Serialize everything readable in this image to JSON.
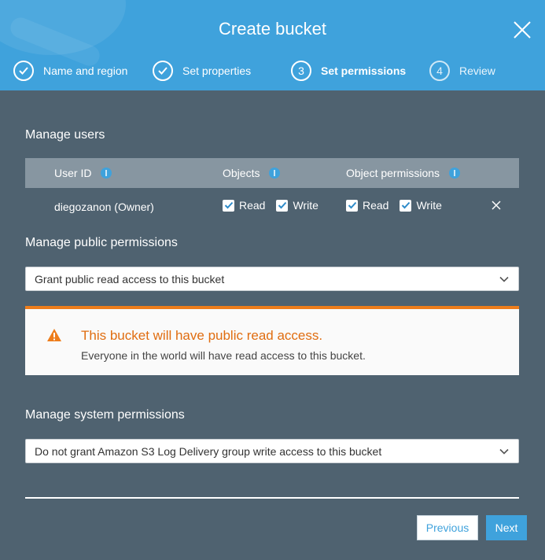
{
  "header": {
    "title": "Create bucket",
    "steps": [
      {
        "number": "",
        "label": "Name and region",
        "state": "done"
      },
      {
        "number": "",
        "label": "Set properties",
        "state": "done"
      },
      {
        "number": "3",
        "label": "Set permissions",
        "state": "current"
      },
      {
        "number": "4",
        "label": "Review",
        "state": "todo"
      }
    ]
  },
  "manage_users": {
    "title": "Manage users",
    "columns": [
      "User ID",
      "Objects",
      "Object permissions"
    ],
    "rows": [
      {
        "user": "diegozanon (Owner)",
        "objects_read_label": "Read",
        "objects_write_label": "Write",
        "perm_read_label": "Read",
        "perm_write_label": "Write",
        "objects_read": true,
        "objects_write": true,
        "perm_read": true,
        "perm_write": true
      }
    ]
  },
  "public_permissions": {
    "title": "Manage public permissions",
    "selected": "Grant public read access to this bucket"
  },
  "alert": {
    "title": "This bucket will have public read access.",
    "body": "Everyone in the world will have read access to this bucket."
  },
  "system_permissions": {
    "title": "Manage system permissions",
    "selected": "Do not grant Amazon S3 Log Delivery group write access to this bucket"
  },
  "footer": {
    "previous": "Previous",
    "next": "Next"
  },
  "colors": {
    "header_bg": "#3fa2dc",
    "body_bg": "#4f6270",
    "table_head_bg": "#8796a1",
    "warning": "#ee7d1b"
  }
}
